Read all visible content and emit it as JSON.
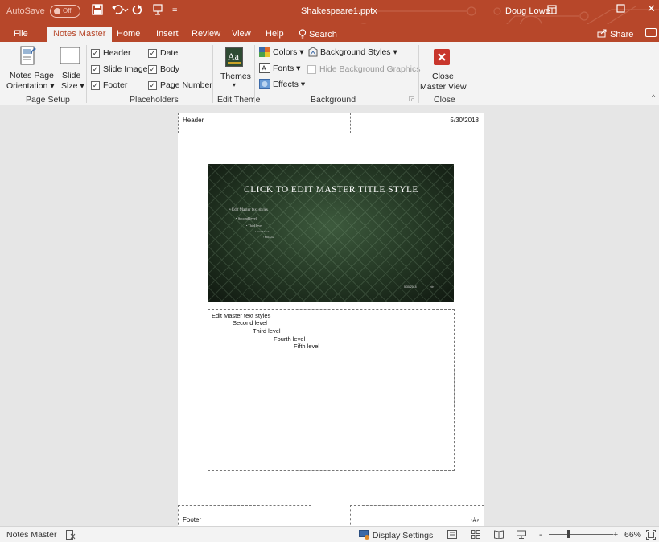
{
  "titlebar": {
    "autosave_label": "AutoSave",
    "autosave_state": "Off",
    "save_icon": "save-icon",
    "undo_icon": "undo-icon",
    "redo_icon": "redo-icon",
    "quick_icon": "customize-icon",
    "doc_title": "Shakespeare1.pptx",
    "user_name": "Doug Lowe",
    "accent": "#b7472a"
  },
  "tabs": {
    "file": "File",
    "notes_master": "Notes Master",
    "home": "Home",
    "insert": "Insert",
    "review": "Review",
    "view": "View",
    "help": "Help",
    "search": "Search",
    "share": "Share"
  },
  "ribbon": {
    "page_setup": {
      "notes_orientation_1": "Notes Page",
      "notes_orientation_2": "Orientation",
      "slide_size_1": "Slide",
      "slide_size_2": "Size",
      "label": "Page Setup"
    },
    "placeholders": {
      "header": "Header",
      "slide_image": "Slide Image",
      "footer": "Footer",
      "date": "Date",
      "body": "Body",
      "page_number": "Page Number",
      "label": "Placeholders"
    },
    "edit_theme": {
      "themes": "Themes",
      "label": "Edit Theme"
    },
    "background": {
      "colors": "Colors",
      "fonts": "Fonts",
      "effects": "Effects",
      "background_styles": "Background Styles",
      "hide_background": "Hide Background Graphics",
      "label": "Background"
    },
    "close": {
      "close_1": "Close",
      "close_2": "Master View",
      "label": "Close"
    }
  },
  "page": {
    "header": "Header",
    "date": "5/30/2018",
    "footer": "Footer",
    "page_number": "‹#›",
    "slide": {
      "title": "CLICK TO EDIT MASTER TITLE STYLE",
      "levels": [
        "Edit Master text styles",
        "Second level",
        "Third level",
        "Fourth level",
        "Fifth level"
      ],
      "footer_date": "5/30/2018",
      "footer_num": "‹#›"
    },
    "notes": [
      "Edit Master text styles",
      "Second level",
      "Third level",
      "Fourth level",
      "Fifth level"
    ]
  },
  "status": {
    "view_name": "Notes Master",
    "display_settings": "Display Settings",
    "zoom_out": "-",
    "zoom_in": "+",
    "zoom": "66%"
  }
}
